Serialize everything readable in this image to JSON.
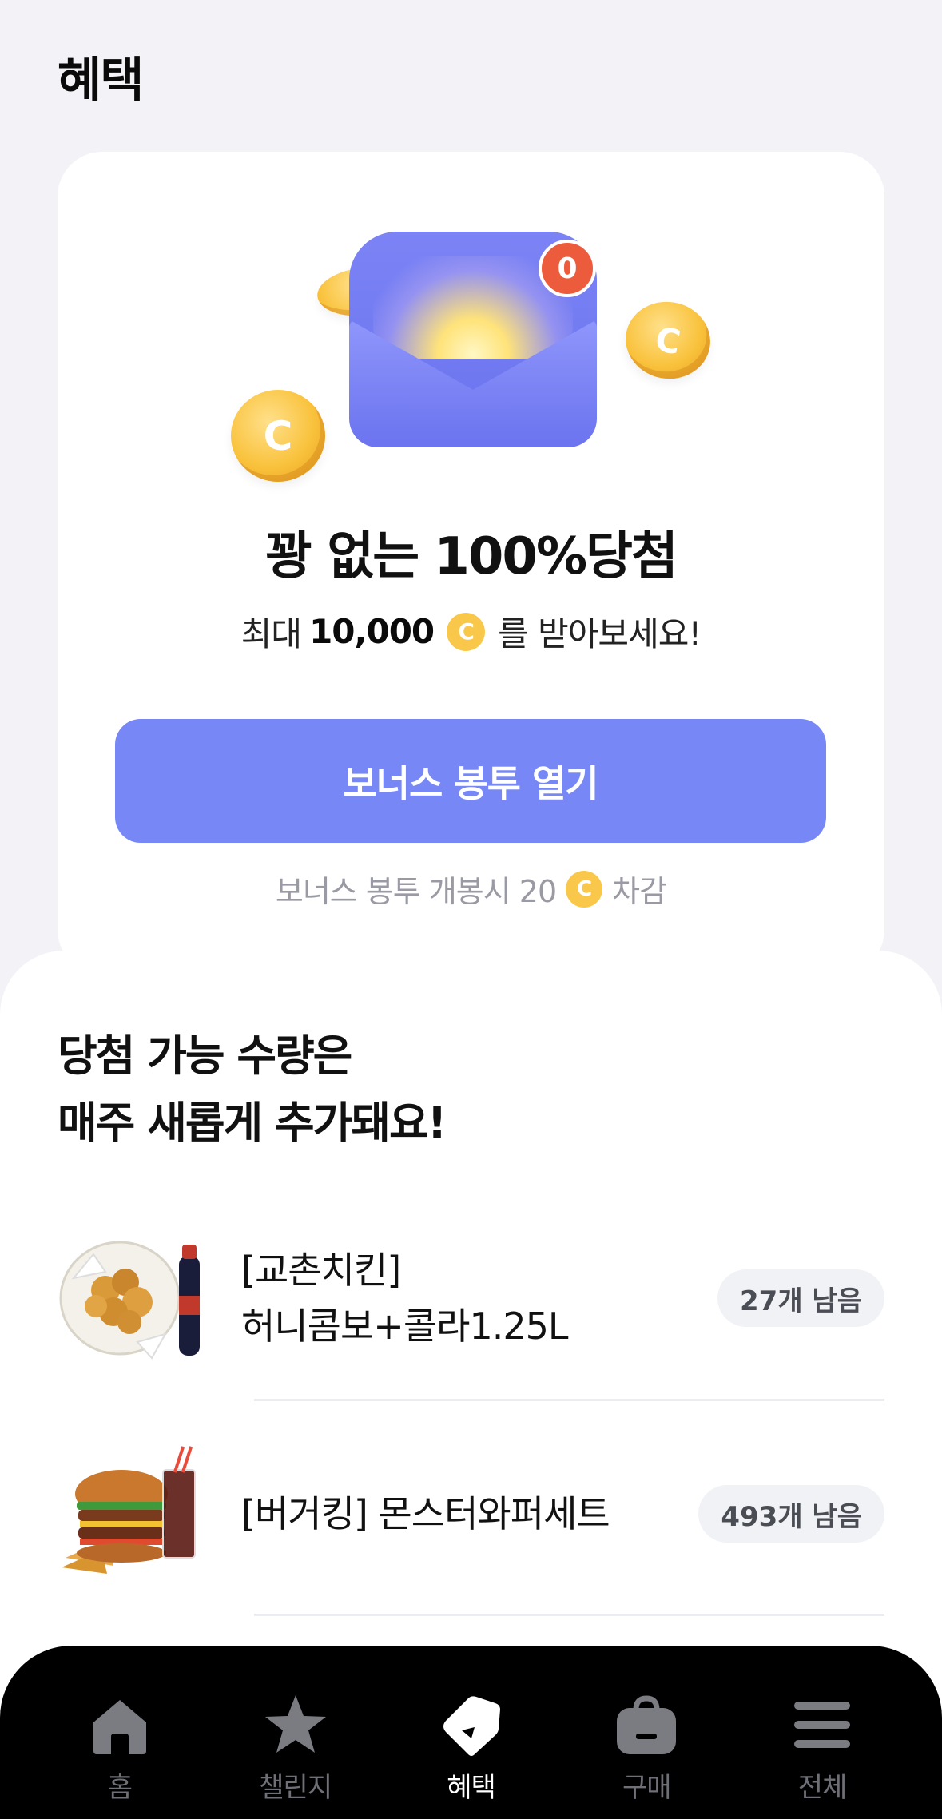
{
  "header": {
    "title": "혜택"
  },
  "promo": {
    "badge_count": "0",
    "headline": "꽝 없는 100%당첨",
    "sub_prefix": "최대",
    "sub_amount": "10,000",
    "sub_suffix": "를 받아보세요!",
    "coin_symbol": "C",
    "cta_label": "보너스 봉투 열기",
    "cost_prefix": "보너스 봉투 개봉시 20",
    "cost_suffix": "차감"
  },
  "prizes": {
    "heading_line1": "당첨 가능 수량은",
    "heading_line2": "매주 새롭게 추가돼요!",
    "items": [
      {
        "name_line1": "[교촌치킨]",
        "name_line2": "허니콤보+콜라1.25L",
        "stock": "27개 남음",
        "icon": "chicken-set-image"
      },
      {
        "name_line1": "[버거킹] 몬스터와퍼세트",
        "name_line2": "",
        "stock": "493개 남음",
        "icon": "burger-set-image"
      }
    ]
  },
  "nav": {
    "items": [
      {
        "label": "홈",
        "icon": "home-icon",
        "active": false
      },
      {
        "label": "챌린지",
        "icon": "star-icon",
        "active": false
      },
      {
        "label": "혜택",
        "icon": "tag-icon",
        "active": true
      },
      {
        "label": "구매",
        "icon": "bag-icon",
        "active": false
      },
      {
        "label": "전체",
        "icon": "menu-icon",
        "active": false
      }
    ]
  },
  "colors": {
    "accent": "#7788f6",
    "badge": "#ec5b3c",
    "coin": "#f9c84a",
    "nav_bg": "#000000"
  }
}
